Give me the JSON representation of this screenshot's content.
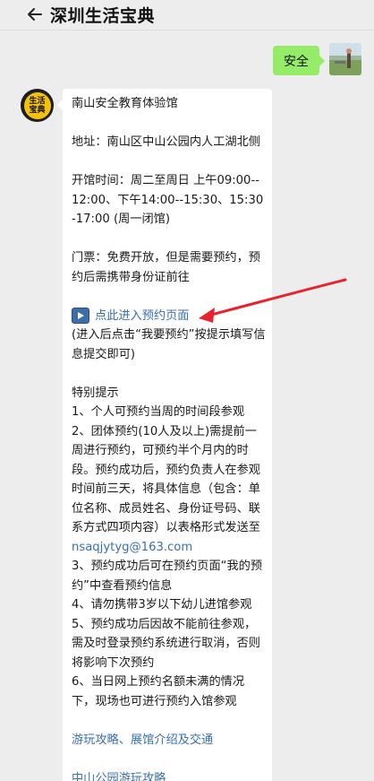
{
  "header": {
    "title": "深圳生活宝典",
    "back_icon": "arrow-left-icon"
  },
  "outgoing": {
    "text": "安全"
  },
  "bot": {
    "avatar_text_line1": "生活",
    "avatar_text_line2": "宝典"
  },
  "message": {
    "venue": "南山安全教育体验馆",
    "address": "地址：南山区中山公园内人工湖北侧",
    "hours": "开馆时间：周二至周日 上午09:00--12:00、下午14:00--15:30、15:30-17:00 (周一闭馆)",
    "ticket": "门票：免费开放，但是需要预约，预约后需携带身份证前往",
    "booking_link": "点此进入预约页面",
    "booking_note": "(进入后点击“我要预约”按提示填写信息提交即可)",
    "tips_title": "特别提示",
    "tip1": "1、个人可预约当周的时间段参观",
    "tip2_prefix": "2、团体预约(10人及以上)需提前一周进行预约，可预约半个月内的时段。预约成功后，预约负责人在参观时间前三天，将具体信息（包含：单位名称、成员姓名、身份证号码、联系方式四项内容）以表格形式发送至",
    "tip2_email": "nsaqjytyg@163.com",
    "tip3": "3、预约成功后可在预约页面“我的预约”中查看预约信息",
    "tip4": "4、请勿携带3岁以下幼儿进馆参观",
    "tip5": "5、预约成功后因故不能前往参观，需及时登录预约系统进行取消，否则将影响下次预约",
    "tip6": "6、当日网上预约名额未满的情况下，现场也可进行预约入馆参观",
    "link_guide": "游玩攻略、展馆介绍及交通",
    "link_park": "中山公园游玩攻略"
  },
  "colors": {
    "background": "#ededed",
    "outgoing_bubble": "#95ec69",
    "link": "#3a6fb0",
    "annotation_arrow": "#e8232e"
  }
}
